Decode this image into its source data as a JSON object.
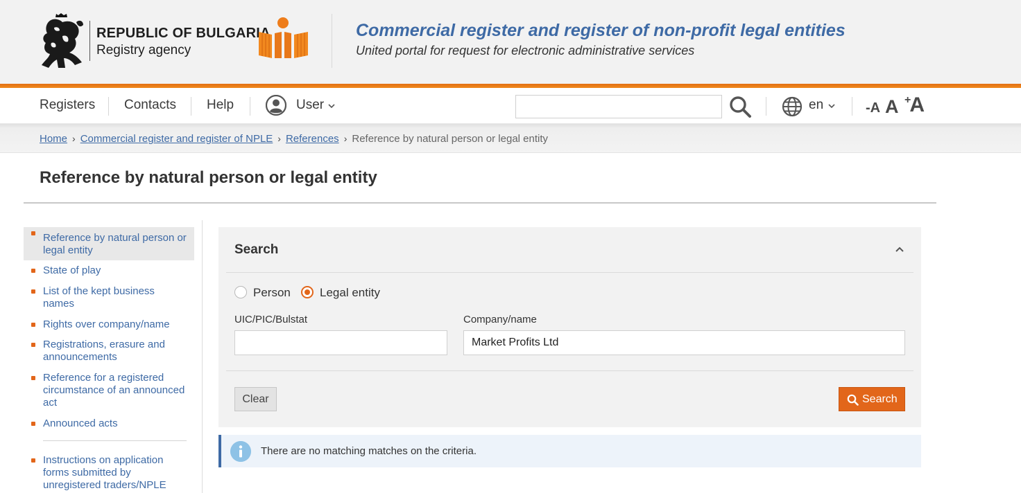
{
  "header": {
    "republic": "REPUBLIC OF BULGARIA",
    "agency": "Registry agency",
    "portal_title": "Commercial register and register of non-profit legal entities",
    "portal_subtitle": "United portal for request for electronic administrative services"
  },
  "nav": {
    "registers": "Registers",
    "contacts": "Contacts",
    "help": "Help",
    "user": "User",
    "search_value": "",
    "language": "en",
    "font_decrease": "-A",
    "font_normal": "A",
    "font_increase": "A",
    "font_increase_plus": "+"
  },
  "breadcrumb": {
    "home": "Home",
    "register": "Commercial register and register of NPLE",
    "references": "References",
    "current": "Reference by natural person or legal entity"
  },
  "page": {
    "title": "Reference by natural person or legal entity"
  },
  "sidebar": {
    "items": [
      {
        "label": "Reference by natural person or legal entity"
      },
      {
        "label": "State of play"
      },
      {
        "label": "List of the kept business names"
      },
      {
        "label": "Rights over company/name"
      },
      {
        "label": "Registrations, erasure and announcements"
      },
      {
        "label": "Reference for a registered circumstance of an announced act"
      },
      {
        "label": "Announced acts"
      },
      {
        "label": "Instructions on application forms submitted by unregistered traders/NPLE"
      }
    ]
  },
  "search_panel": {
    "title": "Search",
    "radio_person": "Person",
    "radio_legal": "Legal entity",
    "selected": "Legal entity",
    "uic_label": "UIC/PIC/Bulstat",
    "uic_value": "",
    "company_label": "Company/name",
    "company_value": "Market Profits Ltd",
    "clear_label": "Clear",
    "search_label": "Search"
  },
  "message": {
    "text": "There are no matching matches on the criteria."
  },
  "colors": {
    "accent": "#e2661a",
    "link": "#3e6aa5",
    "info_bg": "#edf3fa"
  }
}
